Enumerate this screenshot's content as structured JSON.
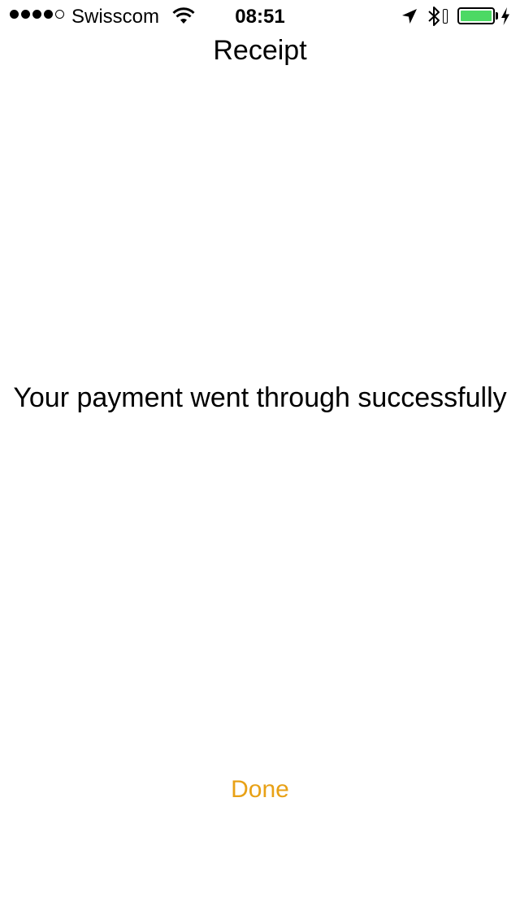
{
  "status_bar": {
    "signal_bars_filled": 4,
    "signal_bars_total": 5,
    "carrier": "Swisscom",
    "wifi_icon": "wifi-icon",
    "time": "08:51",
    "location_icon": "location-arrow-icon",
    "bluetooth_icon": "bluetooth-icon",
    "battery_level": 1.0,
    "battery_color": "#4cd964",
    "charging_icon": "charging-bolt-icon"
  },
  "nav": {
    "title": "Receipt"
  },
  "main": {
    "message": "Your payment went through successfully"
  },
  "actions": {
    "done_label": "Done",
    "done_color": "#e8a116"
  }
}
